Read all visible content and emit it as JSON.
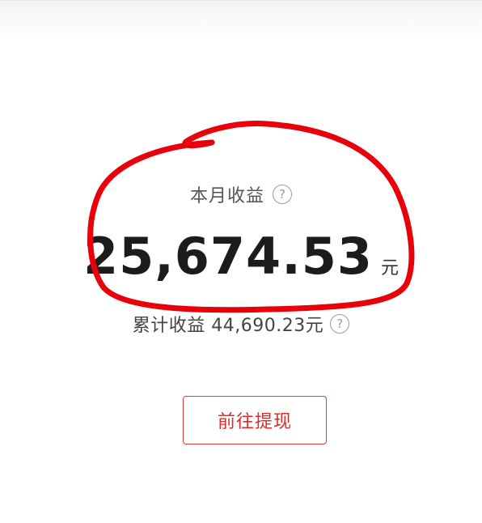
{
  "earnings": {
    "monthly_label": "本月收益",
    "monthly_value": "25,674.53",
    "monthly_unit": "元",
    "total_text": "累计收益 44,690.23元",
    "help_glyph": "?"
  },
  "actions": {
    "withdraw_label": "前往提现"
  },
  "colors": {
    "annotation_circle": "#e8000b",
    "accent_red": "#e23a3a"
  }
}
